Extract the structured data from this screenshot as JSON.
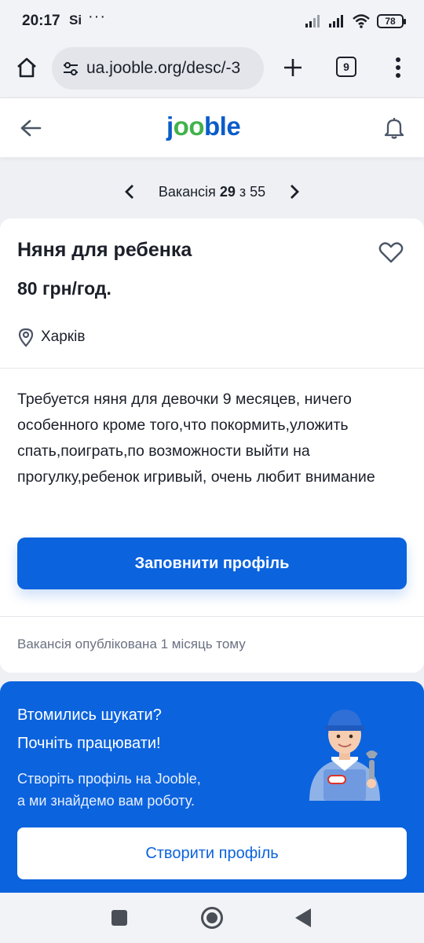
{
  "status_bar": {
    "time": "20:17",
    "carrier_glyph": "Si",
    "more_indicator": "···",
    "battery": "78",
    "icons": [
      "signal-icon",
      "signal-icon",
      "wifi-icon",
      "battery-icon"
    ]
  },
  "browser": {
    "url": "ua.jooble.org/desc/-3",
    "tab_count": "9",
    "icons": [
      "home-icon",
      "site-settings-icon",
      "new-tab-icon",
      "tabs-icon",
      "menu-icon"
    ]
  },
  "header": {
    "logo": {
      "part1": "j",
      "part2": "oo",
      "part3": "ble"
    },
    "icons": [
      "back-arrow-icon",
      "bell-icon"
    ],
    "colors": {
      "brand_blue": "#0a5cc9",
      "brand_green": "#41b24b"
    }
  },
  "pager": {
    "prefix": "Вакансія",
    "current": "29",
    "separator": "з",
    "total": "55"
  },
  "job": {
    "title": "Няня для ребенка",
    "salary": "80 грн/год.",
    "location": "Харків",
    "description": "Требуется няня для девочки 9 месяцев, ничего особенного кроме того,что покормить,уложить спать,поиграть,по возможности выйти на прогулку,ребенок игривый, очень любит внимание",
    "apply_label": "Заповнити профіль",
    "posted": "Вакансія опублікована 1 місяць тому",
    "accent_color": "#0b63de"
  },
  "promo": {
    "heading1": "Втомились шукати?",
    "heading2": "Почніть працювати!",
    "line1": "Створіть профіль на Jooble,",
    "line2": "а ми знайдемо вам роботу.",
    "button_label": "Створити профіль",
    "image": "worker-illustration"
  },
  "nav": {
    "icons": [
      "recents-icon",
      "home-circle-icon",
      "back-triangle-icon"
    ]
  }
}
